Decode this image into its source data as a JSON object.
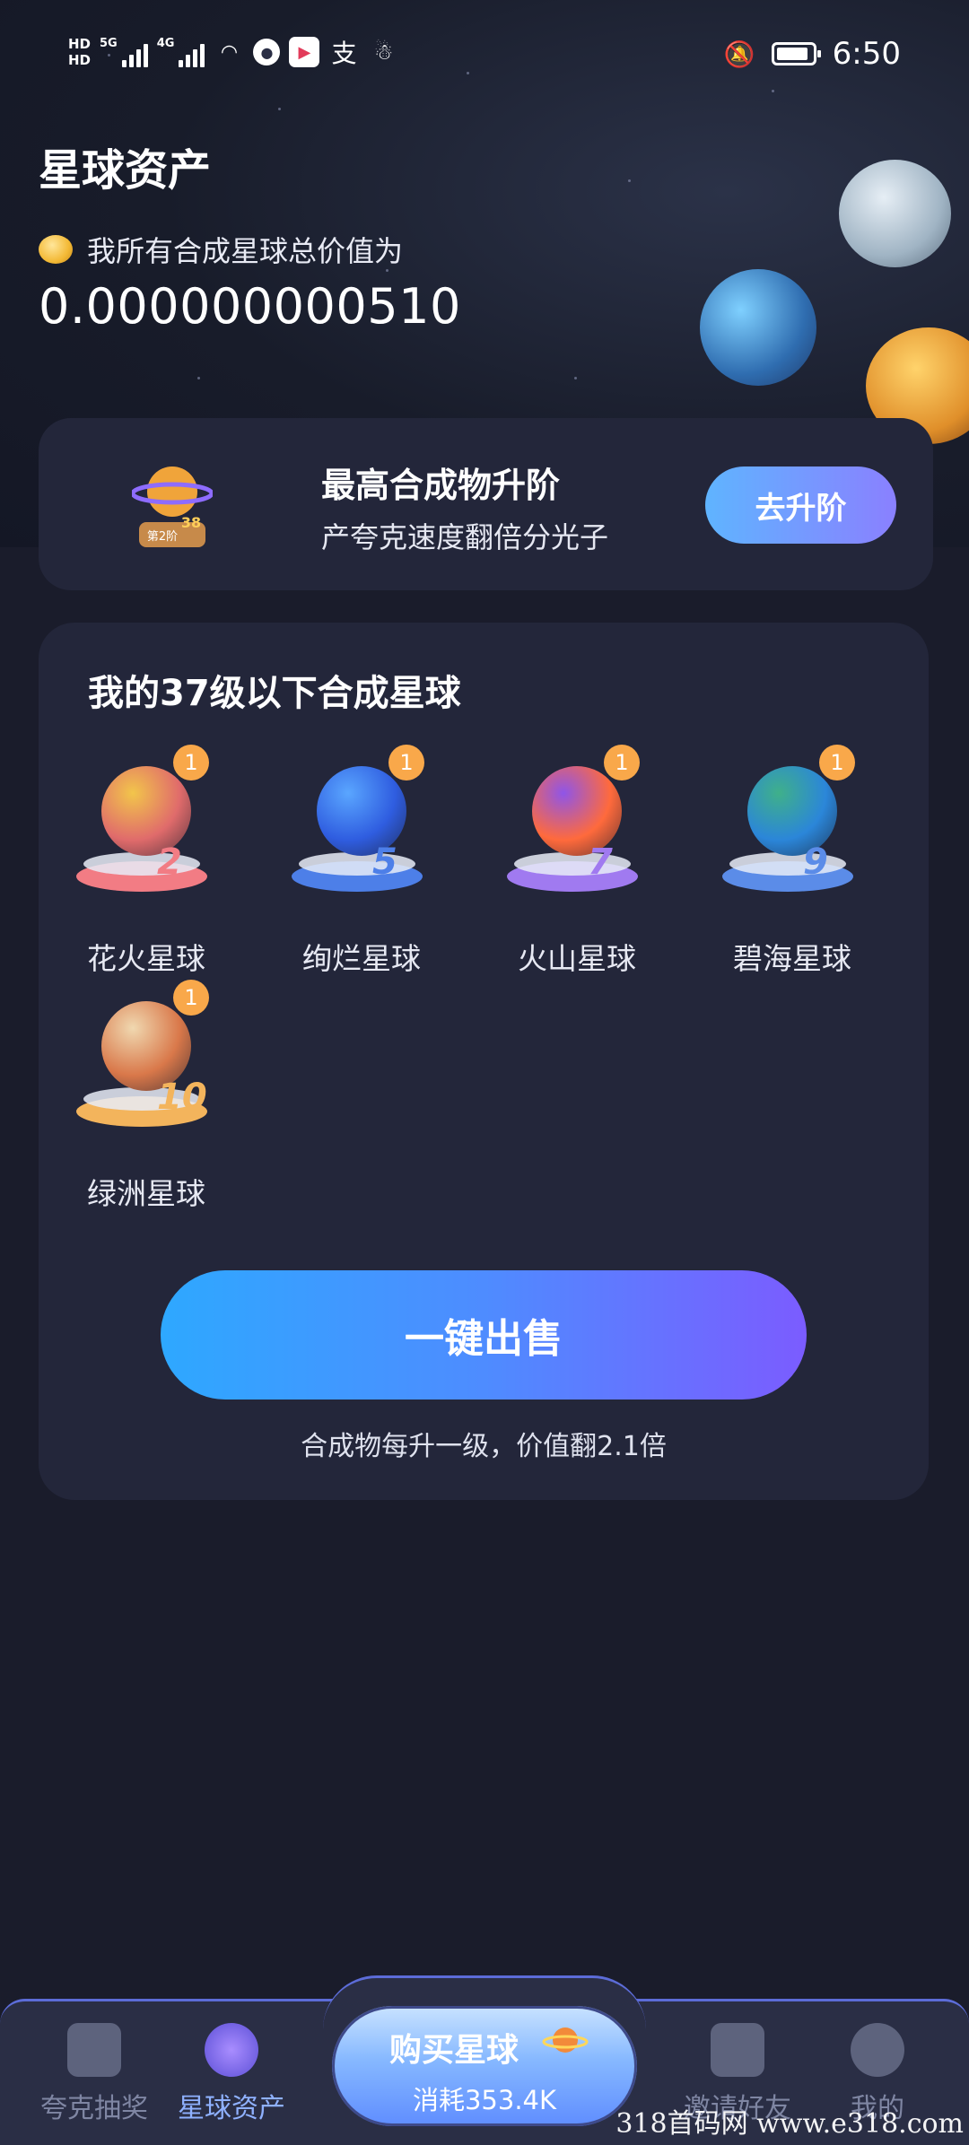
{
  "status_bar": {
    "hd1": "HD",
    "hd2": "HD",
    "net1": "5G",
    "net2": "4G",
    "time": "6:50"
  },
  "header": {
    "title": "星球资产",
    "total_label": "我所有合成星球总价值为",
    "total_value": "0.000000000510"
  },
  "upgrade": {
    "title": "最高合成物升阶",
    "subtitle": "产夸克速度翻倍分光子",
    "button": "去升阶",
    "stage_label": "第2阶",
    "stage_level": "38"
  },
  "planets_section": {
    "title": "我的37级以下合成星球",
    "items": [
      {
        "name": "花火星球",
        "level": "2",
        "count": "1",
        "color": "#e06b6b",
        "accent": "#f2c54b",
        "base": "#f27c84"
      },
      {
        "name": "绚烂星球",
        "level": "5",
        "count": "1",
        "color": "#2f5de0",
        "accent": "#5aa6ff",
        "base": "#4d7fe8"
      },
      {
        "name": "火山星球",
        "level": "7",
        "count": "1",
        "color": "#ff6a3c",
        "accent": "#8f55e8",
        "base": "#a07af0"
      },
      {
        "name": "碧海星球",
        "level": "9",
        "count": "1",
        "color": "#2b86d9",
        "accent": "#3fb08a",
        "base": "#5b8ce8"
      },
      {
        "name": "绿洲星球",
        "level": "10",
        "count": "1",
        "color": "#d9784a",
        "accent": "#f0d8b0",
        "base": "#f3b45c"
      }
    ],
    "sell_button": "一键出售",
    "note": "合成物每升一级，价值翻2.1倍"
  },
  "bottom_nav": {
    "items": [
      {
        "label": "夸克抽奖",
        "icon": "gift-icon"
      },
      {
        "label": "星球资产",
        "icon": "planet-icon"
      },
      {
        "label": "邀请好友",
        "icon": "invite-icon"
      },
      {
        "label": "我的",
        "icon": "user-icon"
      }
    ],
    "buy": {
      "title": "购买星球",
      "sub": "消耗353.4K"
    }
  },
  "watermark": "318首码网  www.e318.com"
}
